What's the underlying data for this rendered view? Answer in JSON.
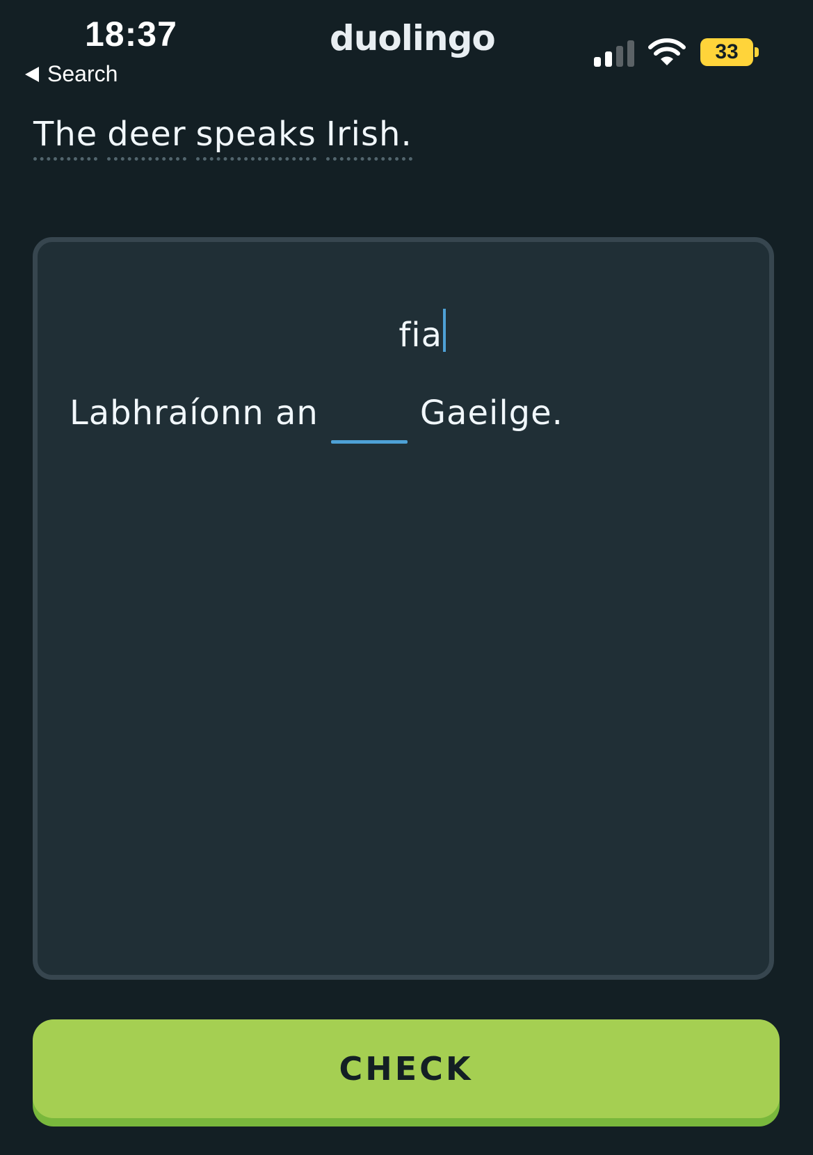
{
  "status_bar": {
    "time": "18:37",
    "back_label": "Search",
    "app_name": "duolingo",
    "battery_level": "33",
    "signal_bars_filled": 2,
    "signal_bars_total": 4,
    "battery_color": "#ffd43a"
  },
  "prompt": {
    "words": [
      "The",
      "deer",
      "speaks",
      "Irish."
    ]
  },
  "answer": {
    "before_blank": "Labhraíonn an",
    "typed_text": "fia",
    "after_blank": "Gaeilge."
  },
  "check_button": {
    "label": "CHECK",
    "color": "#a5cf52"
  },
  "theme": {
    "background": "#131f24",
    "panel": "#202f36",
    "panel_border": "#37464f",
    "accent_blue": "#4ea1d6"
  }
}
